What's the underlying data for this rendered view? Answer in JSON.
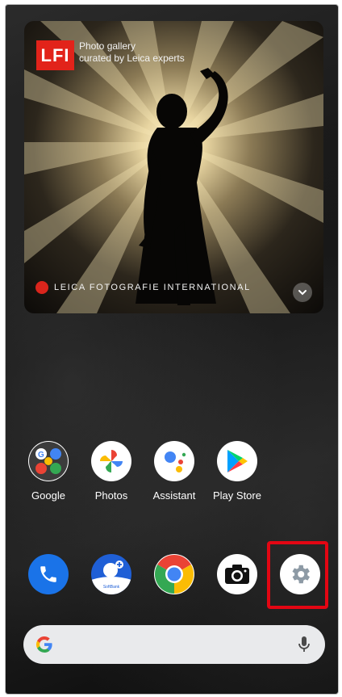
{
  "widget": {
    "logo_text": "LFI",
    "title": "Photo gallery",
    "subtitle": "curated by Leica experts",
    "brand": "LEICA FOTOGRAFIE INTERNATIONAL",
    "expand_icon": "chevron-down-icon"
  },
  "apps_row": [
    {
      "label": "Google",
      "icon": "google-folder-icon"
    },
    {
      "label": "Photos",
      "icon": "google-photos-icon"
    },
    {
      "label": "Assistant",
      "icon": "google-assistant-icon"
    },
    {
      "label": "Play Store",
      "icon": "play-store-icon"
    }
  ],
  "dock": [
    {
      "icon": "phone-icon"
    },
    {
      "icon": "softbank-icon",
      "text": "SoftBank"
    },
    {
      "icon": "chrome-icon"
    },
    {
      "icon": "camera-icon"
    },
    {
      "icon": "settings-icon",
      "highlighted": true
    }
  ],
  "search": {
    "logo_icon": "google-g-icon",
    "mic_icon": "mic-icon"
  },
  "colors": {
    "highlight": "#e30613",
    "lfi_red": "#e2231a",
    "phone_blue": "#1a73e8"
  }
}
